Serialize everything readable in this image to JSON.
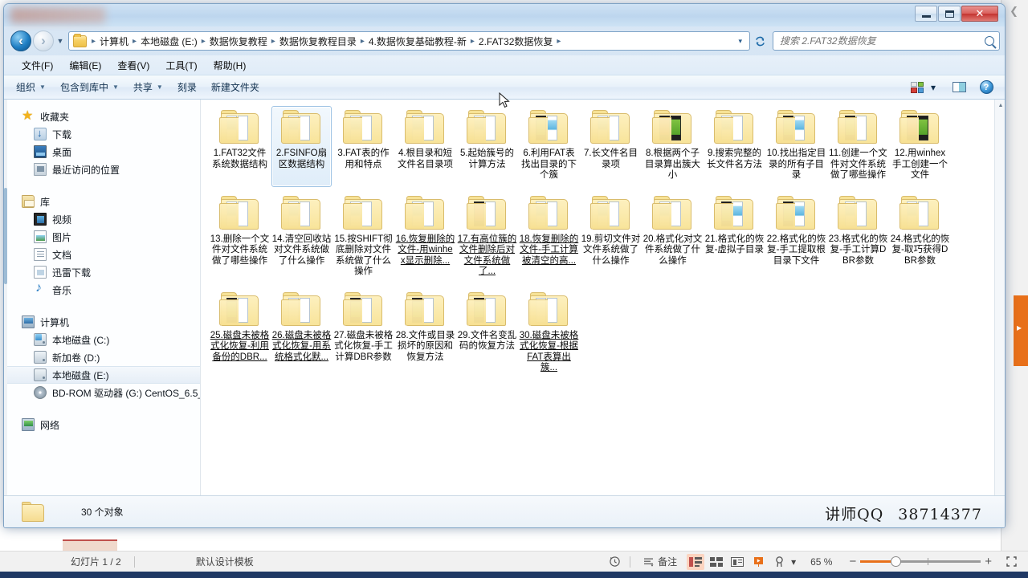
{
  "window": {
    "title": "",
    "minimize_label": "最小化",
    "maximize_label": "最大化",
    "close_label": "关闭"
  },
  "address_bar": {
    "back_tooltip": "后退",
    "forward_tooltip": "前进",
    "recent_tooltip": "最近浏览的位置",
    "breadcrumbs": [
      "计算机",
      "本地磁盘 (E:)",
      "数据恢复教程",
      "数据恢复教程目录",
      "4.数据恢复基础教程-新",
      "2.FAT32数据恢复"
    ],
    "separator": "▸",
    "dropdown": "▾",
    "refresh": "↻"
  },
  "search": {
    "placeholder": "搜索 2.FAT32数据恢复",
    "icon": "search-icon"
  },
  "menubar": {
    "items": [
      "文件(F)",
      "编辑(E)",
      "查看(V)",
      "工具(T)",
      "帮助(H)"
    ]
  },
  "commandbar": {
    "items": [
      {
        "label": "组织",
        "has_caret": true
      },
      {
        "label": "包含到库中",
        "has_caret": true
      },
      {
        "label": "共享",
        "has_caret": true
      },
      {
        "label": "刻录",
        "has_caret": false
      },
      {
        "label": "新建文件夹",
        "has_caret": false
      }
    ],
    "views_tooltip": "更改视图",
    "views_caret": "▾",
    "preview_tooltip": "显示预览窗格",
    "help_tooltip": "帮助",
    "help_glyph": "?"
  },
  "navpane": {
    "groups": [
      {
        "header": {
          "label": "收藏夹",
          "icon": "star-icon"
        },
        "items": [
          {
            "label": "下载",
            "icon": "downloads-icon"
          },
          {
            "label": "桌面",
            "icon": "desktop-icon"
          },
          {
            "label": "最近访问的位置",
            "icon": "recent-places-icon"
          }
        ]
      },
      {
        "header": {
          "label": "库",
          "icon": "library-icon"
        },
        "items": [
          {
            "label": "视频",
            "icon": "video-icon"
          },
          {
            "label": "图片",
            "icon": "pictures-icon"
          },
          {
            "label": "文档",
            "icon": "documents-icon"
          },
          {
            "label": "迅雷下载",
            "icon": "thunder-download-icon"
          },
          {
            "label": "音乐",
            "icon": "music-icon"
          }
        ]
      },
      {
        "header": {
          "label": "计算机",
          "icon": "computer-icon"
        },
        "items": [
          {
            "label": "本地磁盘 (C:)",
            "icon": "system-drive-icon",
            "selected": false
          },
          {
            "label": "新加卷 (D:)",
            "icon": "drive-icon",
            "selected": false
          },
          {
            "label": "本地磁盘 (E:)",
            "icon": "drive-icon",
            "selected": true
          },
          {
            "label": "BD-ROM 驱动器 (G:) CentOS_6.5_",
            "icon": "bdrom-icon",
            "selected": false
          }
        ]
      },
      {
        "header": {
          "label": "网络",
          "icon": "network-icon"
        },
        "items": []
      }
    ]
  },
  "files": [
    {
      "name": "1.FAT32文件系统数据结构",
      "icon": "folder-icon",
      "thumb": "blue",
      "selected": false,
      "truncated": false
    },
    {
      "name": "2.FSINFO扇区数据结构",
      "icon": "folder-icon",
      "thumb": "blue",
      "selected": true,
      "truncated": false
    },
    {
      "name": "3.FAT表的作用和特点",
      "icon": "folder-icon",
      "thumb": "blue",
      "selected": false,
      "truncated": false
    },
    {
      "name": "4.根目录和短文件名目录项",
      "icon": "folder-icon",
      "thumb": "blue",
      "selected": false,
      "truncated": false
    },
    {
      "name": "5.起始簇号的计算方法",
      "icon": "folder-icon",
      "thumb": "blue",
      "selected": false,
      "truncated": false
    },
    {
      "name": "6.利用FAT表找出目录的下个簇",
      "icon": "folder-icon",
      "thumb": "green-blue",
      "selected": false,
      "truncated": false
    },
    {
      "name": "7.长文件名目录项",
      "icon": "folder-icon",
      "thumb": "blue",
      "selected": false,
      "truncated": false
    },
    {
      "name": "8.根据两个子目录算出簇大小",
      "icon": "folder-icon",
      "thumb": "red-green",
      "selected": false,
      "truncated": false
    },
    {
      "name": "9.搜索完整的长文件名方法",
      "icon": "folder-icon",
      "thumb": "blue",
      "selected": false,
      "truncated": false
    },
    {
      "name": "10.找出指定目录的所有子目录",
      "icon": "folder-icon",
      "thumb": "green-blue",
      "selected": false,
      "truncated": false
    },
    {
      "name": "11.创建一个文件对文件系统做了哪些操作",
      "icon": "folder-icon",
      "thumb": "green",
      "selected": false,
      "truncated": false
    },
    {
      "name": "12.用winhex手工创建一个文件",
      "icon": "folder-icon",
      "thumb": "red-green",
      "selected": false,
      "truncated": false
    },
    {
      "name": "13.删除一个文件对文件系统做了哪些操作",
      "icon": "folder-icon",
      "thumb": "blue",
      "selected": false,
      "truncated": false
    },
    {
      "name": "14.清空回收站对文件系统做了什么操作",
      "icon": "folder-icon",
      "thumb": "blue",
      "selected": false,
      "truncated": false
    },
    {
      "name": "15.按SHIFT彻底删除对文件系统做了什么操作",
      "icon": "folder-icon",
      "thumb": "blue",
      "selected": false,
      "truncated": false
    },
    {
      "name": "16.恢复删除的文件-用winhex显示删除...",
      "icon": "folder-icon",
      "thumb": "blue",
      "selected": false,
      "truncated": true
    },
    {
      "name": "17.有高位簇的文件删除后对文件系统做了...",
      "icon": "folder-icon",
      "thumb": "red",
      "selected": false,
      "truncated": true
    },
    {
      "name": "18.恢复删除的文件-手工计算被清空的高...",
      "icon": "folder-icon",
      "thumb": "blue",
      "selected": false,
      "truncated": true
    },
    {
      "name": "19.剪切文件对文件系统做了什么操作",
      "icon": "folder-icon",
      "thumb": "blue",
      "selected": false,
      "truncated": false
    },
    {
      "name": "20.格式化对文件系统做了什么操作",
      "icon": "folder-icon",
      "thumb": "blue",
      "selected": false,
      "truncated": false
    },
    {
      "name": "21.格式化的恢复-虚拟子目录",
      "icon": "folder-icon",
      "thumb": "green-blue",
      "selected": false,
      "truncated": false
    },
    {
      "name": "22.格式化的恢复-手工提取根目录下文件",
      "icon": "folder-icon",
      "thumb": "green-blue",
      "selected": false,
      "truncated": false
    },
    {
      "name": "23.格式化的恢复-手工计算DBR参数",
      "icon": "folder-icon",
      "thumb": "blue",
      "selected": false,
      "truncated": false
    },
    {
      "name": "24.格式化的恢复-取巧获得DBR参数",
      "icon": "folder-icon",
      "thumb": "blue",
      "selected": false,
      "truncated": false
    },
    {
      "name": "25.磁盘未被格式化恢复-利用备份的DBR...",
      "icon": "folder-icon",
      "thumb": "green",
      "selected": false,
      "truncated": true
    },
    {
      "name": "26.磁盘未被格式化恢复-用系统格式化默...",
      "icon": "folder-icon",
      "thumb": "plain",
      "selected": false,
      "truncated": true
    },
    {
      "name": "27.磁盘未被格式化恢复-手工计算DBR参数",
      "icon": "folder-icon",
      "thumb": "green",
      "selected": false,
      "truncated": false
    },
    {
      "name": "28.文件或目录损坏的原因和恢复方法",
      "icon": "folder-icon",
      "thumb": "green",
      "selected": false,
      "truncated": false
    },
    {
      "name": "29.文件名变乱码的恢复方法",
      "icon": "folder-icon",
      "thumb": "green",
      "selected": false,
      "truncated": false
    },
    {
      "name": "30.磁盘未被格式化恢复-根据FAT表算出簇...",
      "icon": "folder-icon",
      "thumb": "plain",
      "selected": false,
      "truncated": true
    }
  ],
  "details_bar": {
    "count_text": "30 个对象",
    "folder_icon": "folder-icon"
  },
  "watermark": {
    "label": "讲师QQ",
    "number": "38714377"
  },
  "powerpoint_status": {
    "slide_text": "幻灯片 1 / 2",
    "template_text": "默认设计模板",
    "history_icon": "undo-history-icon",
    "notes_label": "备注",
    "view_normal": "normal-view-icon",
    "view_sorter": "slide-sorter-icon",
    "view_reading": "reading-view-icon",
    "view_slideshow": "slideshow-icon",
    "accessibility_icon": "accessibility-icon",
    "accessibility_caret": "▾",
    "zoom_level": "65 %",
    "zoom_out": "−",
    "zoom_in": "+",
    "fit_icon": "fit-to-window-icon"
  },
  "colors": {
    "accent_orange": "#e8701a",
    "titlebar_blue": "#bdd6ee",
    "selection_blue": "#9fc3e4",
    "taskbar_navy": "#1f3864"
  }
}
